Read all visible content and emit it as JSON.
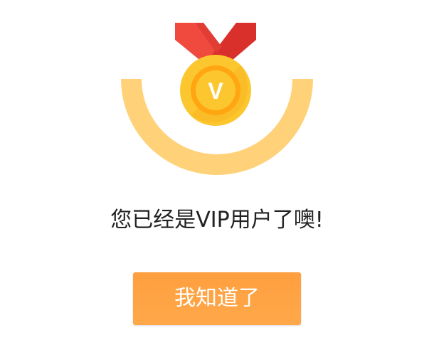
{
  "dialog": {
    "badge_letter": "V",
    "message": "您已经是VIP用户了噢!",
    "confirm_label": "我知道了"
  },
  "colors": {
    "arc": "#ffd27a",
    "ribbon_left": "#f04a3e",
    "ribbon_right": "#d9302c",
    "medal_outer": "#fcc72e",
    "medal_inner": "#ffa612",
    "button": "#ffa040",
    "text": "#222222"
  },
  "icons": {
    "badge": "vip-medal-icon"
  }
}
